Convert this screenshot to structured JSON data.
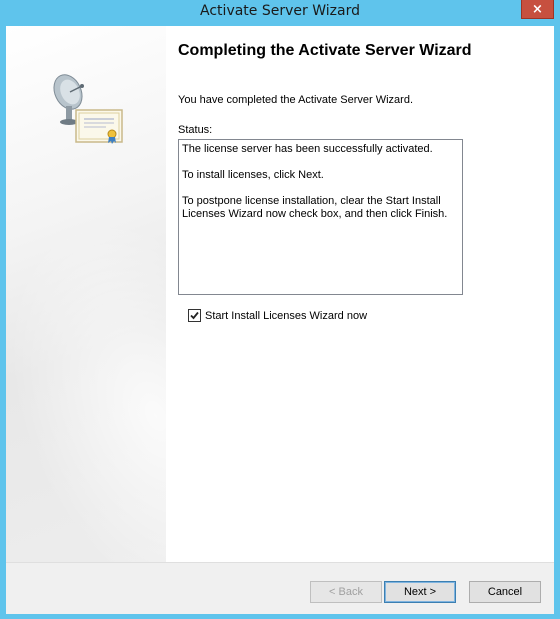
{
  "window": {
    "title": "Activate Server Wizard",
    "close_glyph": "×"
  },
  "main": {
    "heading": "Completing the Activate Server Wizard",
    "intro": "You have completed the Activate Server Wizard.",
    "status_label": "Status:",
    "status_lines": [
      "The license server has been successfully activated.",
      "To install licenses, click Next.",
      "To postpone license installation, clear the Start Install Licenses Wizard now check box, and then click Finish."
    ],
    "checkbox": {
      "label": "Start Install Licenses Wizard now",
      "checked": true
    }
  },
  "footer": {
    "back_label": "< Back",
    "next_label": "Next >",
    "cancel_label": "Cancel"
  },
  "icons": {
    "sidebar_art": "satellite-certificate-icon",
    "checkmark": "checkmark-icon",
    "close": "close-icon"
  },
  "colors": {
    "frame": "#5fc4ec",
    "close_button": "#c7503f"
  }
}
